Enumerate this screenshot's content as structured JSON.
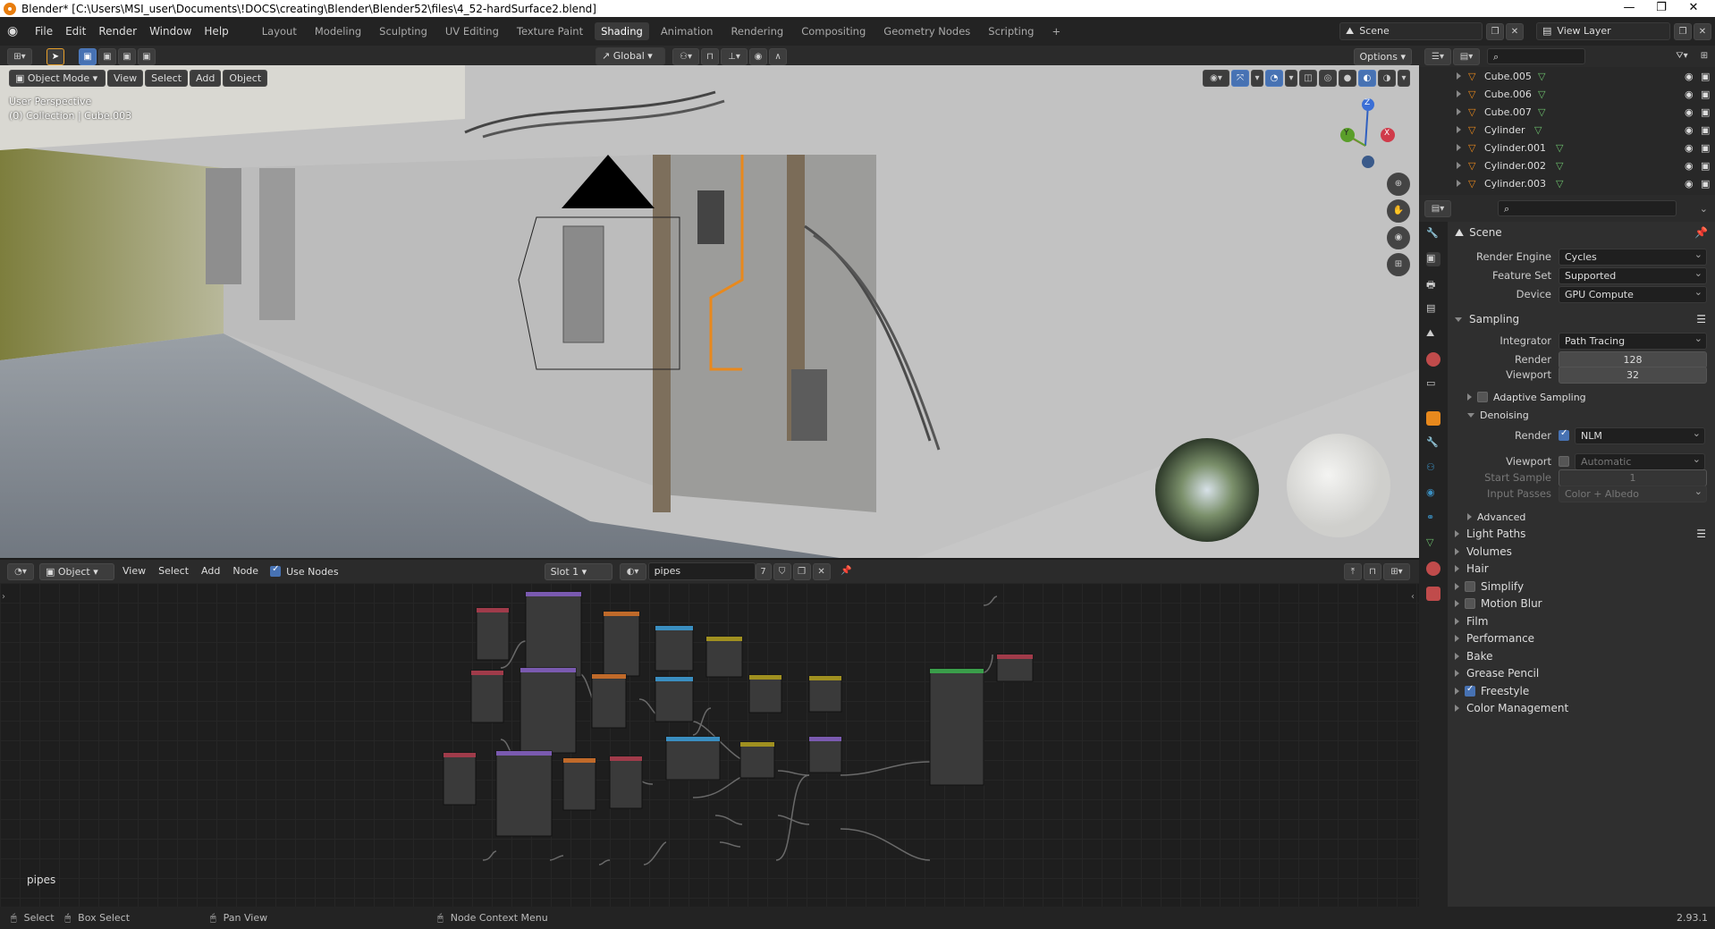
{
  "window": {
    "title": "Blender* [C:\\Users\\MSI_user\\Documents\\!DOCS\\creating\\Blender\\Blender52\\files\\4_52-hardSurface2.blend]",
    "min": "—",
    "max": "❐",
    "close": "✕"
  },
  "menus": [
    "File",
    "Edit",
    "Render",
    "Window",
    "Help"
  ],
  "workspaces": [
    "Layout",
    "Modeling",
    "Sculpting",
    "UV Editing",
    "Texture Paint",
    "Shading",
    "Animation",
    "Rendering",
    "Compositing",
    "Geometry Nodes",
    "Scripting"
  ],
  "active_workspace": "Shading",
  "add_workspace": "+",
  "scene": {
    "name": "Scene",
    "view_layer": "View Layer"
  },
  "viewport": {
    "transform_orientation": "Global",
    "options": "Options",
    "mode": "Object Mode",
    "menus": [
      "View",
      "Select",
      "Add",
      "Object"
    ],
    "perspective": "User Perspective",
    "collection_info": "(0) Collection | Cube.003",
    "gizmo_axes": {
      "z": "Z",
      "x": "X",
      "y": "Y"
    }
  },
  "node_editor": {
    "type": "Object",
    "menus": [
      "View",
      "Select",
      "Add",
      "Node"
    ],
    "use_nodes_label": "Use Nodes",
    "use_nodes": true,
    "slot": "Slot 1",
    "material": "pipes",
    "users": "7",
    "material_label": "pipes"
  },
  "outliner": {
    "items": [
      {
        "name": "Cube.005"
      },
      {
        "name": "Cube.006"
      },
      {
        "name": "Cube.007"
      },
      {
        "name": "Cylinder"
      },
      {
        "name": "Cylinder.001"
      },
      {
        "name": "Cylinder.002"
      },
      {
        "name": "Cylinder.003"
      }
    ]
  },
  "properties": {
    "context": "Scene",
    "render_engine_label": "Render Engine",
    "render_engine": "Cycles",
    "feature_set_label": "Feature Set",
    "feature_set": "Supported",
    "device_label": "Device",
    "device": "GPU Compute",
    "sampling": {
      "title": "Sampling",
      "integrator_label": "Integrator",
      "integrator": "Path Tracing",
      "render_label": "Render",
      "render": "128",
      "viewport_label": "Viewport",
      "viewport": "32",
      "adaptive_label": "Adaptive Sampling",
      "denoising_label": "Denoising",
      "denoise_render_label": "Render",
      "denoise_render": "NLM",
      "denoise_viewport_label": "Viewport",
      "denoise_viewport": "Automatic",
      "start_sample_label": "Start Sample",
      "start_sample": "1",
      "input_passes_label": "Input Passes",
      "input_passes": "Color + Albedo",
      "advanced_label": "Advanced"
    },
    "panels": [
      "Light Paths",
      "Volumes",
      "Hair",
      "Simplify",
      "Motion Blur",
      "Film",
      "Performance",
      "Bake",
      "Grease Pencil",
      "Freestyle",
      "Color Management"
    ]
  },
  "statusbar": {
    "select": "Select",
    "box_select": "Box Select",
    "pan": "Pan View",
    "context_menu": "Node Context Menu",
    "version": "2.93.1"
  }
}
